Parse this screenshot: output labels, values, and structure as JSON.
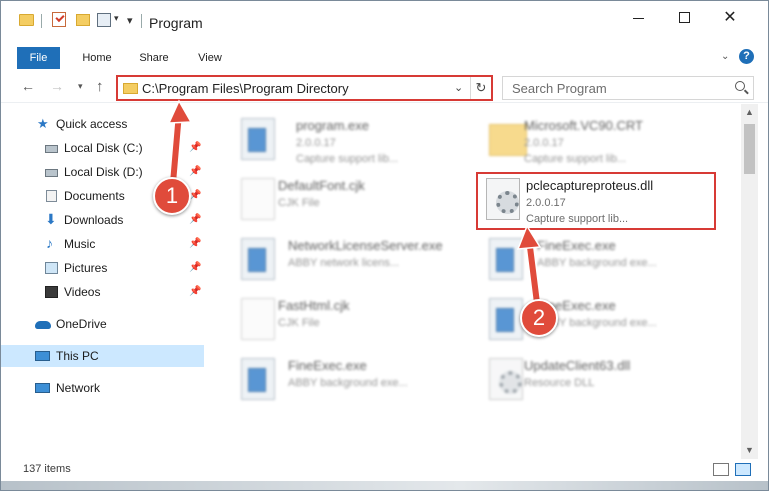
{
  "window": {
    "title": "Program",
    "minimize_icon": "minimize-icon",
    "maximize_icon": "maximize-icon",
    "close_glyph": "✕"
  },
  "ribbon": {
    "tabs": [
      {
        "label": "File"
      },
      {
        "label": "Home"
      },
      {
        "label": "Share"
      },
      {
        "label": "View"
      }
    ],
    "help_glyph": "?",
    "expand_glyph": "⌄"
  },
  "navigation": {
    "back_glyph": "←",
    "forward_glyph": "→",
    "recent_glyph": "▾",
    "up_glyph": "↑",
    "address": "C:\\Program Files\\Program Directory",
    "address_dropdown_glyph": "⌄",
    "refresh_glyph": "↻",
    "search_placeholder": "Search Program"
  },
  "sidebar": {
    "items": [
      {
        "label": "Quick access",
        "icon": "star-icon",
        "pinned": false
      },
      {
        "label": "Local Disk (C:)",
        "icon": "disk-icon",
        "pinned": true
      },
      {
        "label": "Local Disk (D:)",
        "icon": "disk-icon",
        "pinned": true
      },
      {
        "label": "Documents",
        "icon": "documents-icon",
        "pinned": true
      },
      {
        "label": "Downloads",
        "icon": "downloads-icon",
        "pinned": true
      },
      {
        "label": "Music",
        "icon": "music-icon",
        "pinned": true
      },
      {
        "label": "Pictures",
        "icon": "pictures-icon",
        "pinned": true
      },
      {
        "label": "Videos",
        "icon": "videos-icon",
        "pinned": true
      },
      {
        "label": "OneDrive",
        "icon": "onedrive-icon",
        "pinned": false
      },
      {
        "label": "This PC",
        "icon": "pc-icon",
        "pinned": false,
        "selected": true
      },
      {
        "label": "Network",
        "icon": "network-icon",
        "pinned": false
      }
    ],
    "pin_glyph": "📌"
  },
  "files": [
    {
      "name": "program.exe",
      "version": "2.0.0.17",
      "description": "Capture support lib...",
      "type": "exe",
      "blurred": true
    },
    {
      "name": "Microsoft.VC90.CRT",
      "version": "2.0.0.17",
      "description": "Capture support lib...",
      "type": "folder",
      "blurred": true
    },
    {
      "name": "DefaultFont.cjk",
      "version": "CJK File",
      "description": "",
      "type": "doc",
      "blurred": true
    },
    {
      "name": "pclecaptureproteus.dll",
      "version": "2.0.0.17",
      "description": "Capture support lib...",
      "type": "dll",
      "blurred": false,
      "highlighted": true
    },
    {
      "name": "NetworkLicenseServer.exe",
      "version": "ABBY network licens...",
      "description": "",
      "type": "exe",
      "blurred": true
    },
    {
      "name": "FineExec.exe",
      "version": "ABBY background exe...",
      "description": "",
      "type": "exe",
      "blurred": true
    },
    {
      "name": "FastHtml.cjk",
      "version": "CJK File",
      "description": "",
      "type": "doc",
      "blurred": true
    },
    {
      "name": "FineExec.exe",
      "version": "ABBY background exe...",
      "description": "",
      "type": "exe",
      "blurred": true
    },
    {
      "name": "FineExec.exe",
      "version": "ABBY background exe...",
      "description": "",
      "type": "exe",
      "blurred": true
    },
    {
      "name": "UpdateClient63.dll",
      "version": "Resource DLL",
      "description": "",
      "type": "dll",
      "blurred": true
    }
  ],
  "callouts": [
    {
      "number": "1"
    },
    {
      "number": "2"
    }
  ],
  "scrollbar": {
    "up_glyph": "▲",
    "down_glyph": "▼"
  },
  "status": {
    "item_count": "137 items"
  },
  "colors": {
    "accent": "#1f6fb8",
    "callout": "#e04b3b",
    "highlight_border": "#d73a35",
    "selection": "#cce8ff"
  }
}
